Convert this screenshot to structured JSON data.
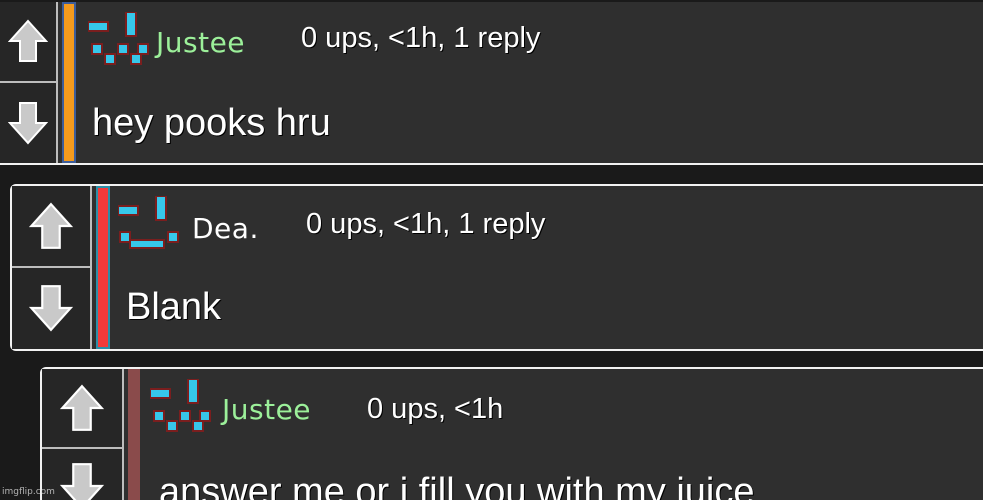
{
  "colors": {
    "username_green": "#9cf09a",
    "username_white": "#ffffff",
    "orange_bar": "#f39a1e",
    "red_bar": "#f23a3a",
    "brown_bar": "#8a4b4b",
    "card_bg": "#2f2f2f"
  },
  "icons": {
    "upvote": "up-arrow-icon",
    "downvote": "down-arrow-icon",
    "avatar": "pixel-face-icon"
  },
  "comments": [
    {
      "username": "Justee",
      "username_color": "#9cf09a",
      "meta": "0 ups, <1h, 1 reply",
      "text": "hey pooks hru",
      "bar_color": "#f39a1e"
    },
    {
      "username": "Dea.",
      "username_color": "#ffffff",
      "meta": "0 ups, <1h, 1 reply",
      "text": "Blank",
      "bar_color": "#f23a3a"
    },
    {
      "username": "Justee",
      "username_color": "#9cf09a",
      "meta": "0 ups, <1h",
      "text": "answer me or i fill you with my juice",
      "bar_color": "#8a4b4b"
    }
  ],
  "watermark": "imgflip.com"
}
